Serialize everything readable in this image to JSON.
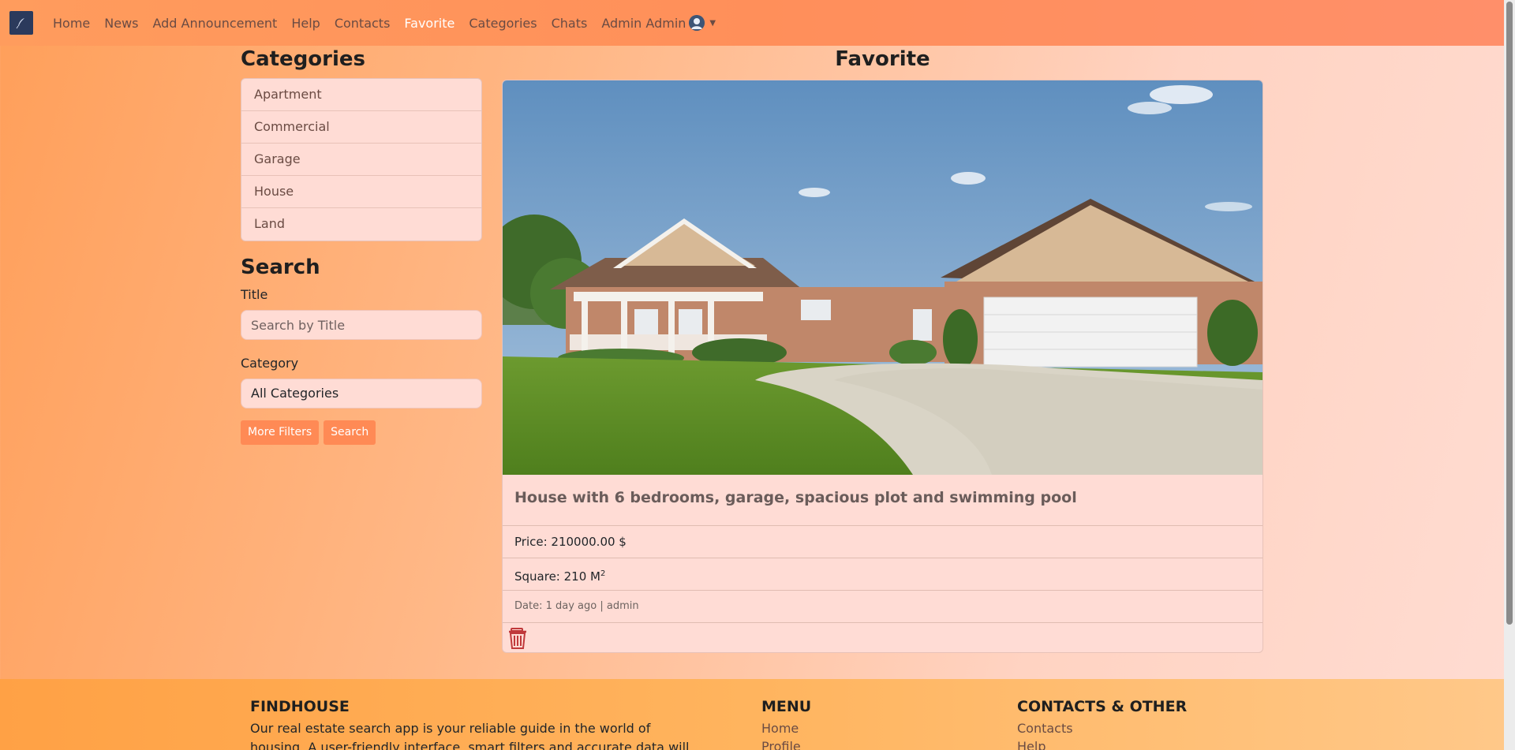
{
  "navbar": {
    "brand_icon": "feather-logo-icon",
    "links": [
      "Home",
      "News",
      "Add Announcement",
      "Help",
      "Contacts",
      "Favorite",
      "Categories",
      "Chats"
    ],
    "active": "Favorite",
    "user_name": "Admin Admin"
  },
  "sidebar": {
    "categories_heading": "Categories",
    "categories": [
      "Apartment",
      "Commercial",
      "Garage",
      "House",
      "Land"
    ],
    "search_heading": "Search",
    "title_label": "Title",
    "title_placeholder": "Search by Title",
    "title_value": "",
    "category_label": "Category",
    "category_selected": "All Categories",
    "more_filters_label": "More Filters",
    "search_button_label": "Search"
  },
  "main": {
    "heading": "Favorite",
    "card": {
      "title": "House with 6 bedrooms, garage, spacious plot and swimming pool",
      "price": "Price: 210000.00 $",
      "square": "Square: 210 M",
      "square_sup": "2",
      "date": "Date: 1 day ago | admin"
    }
  },
  "footer": {
    "brand_heading": "FINDHOUSE",
    "brand_text": "Our real estate search app is your reliable guide in the world of housing. A user-friendly interface, smart filters and accurate data will help you quickly find an",
    "menu_heading": "MENU",
    "menu_links": [
      "Home",
      "Profile"
    ],
    "contacts_heading": "CONTACTS & OTHER",
    "contacts_links": [
      "Contacts",
      "Help"
    ]
  },
  "colors": {
    "accent": "#ff8a55",
    "navbar": "#ff9c5d",
    "active_link": "#ffffff",
    "trash": "#c0393b"
  }
}
